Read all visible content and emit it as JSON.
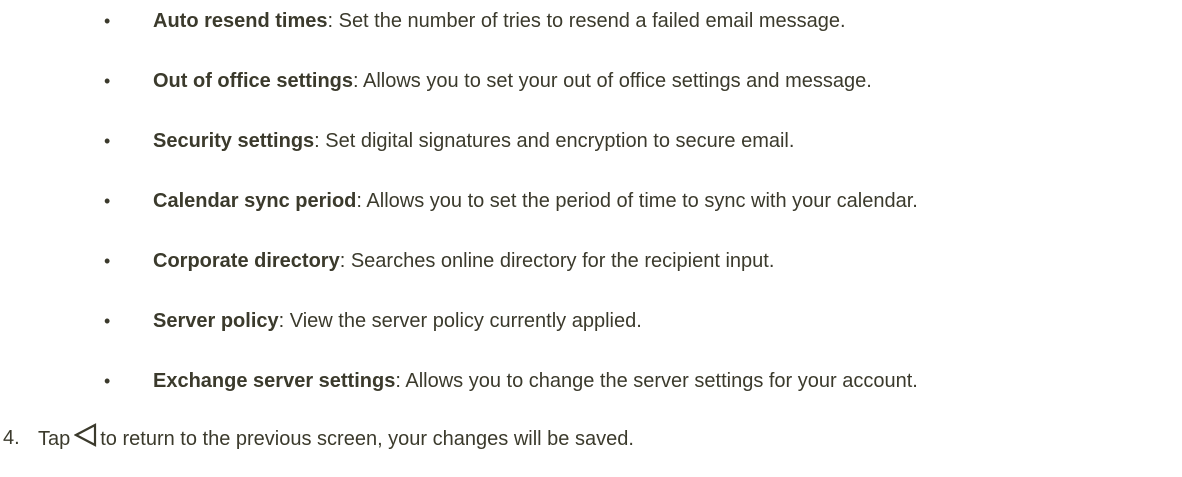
{
  "bullets": [
    {
      "term": "Auto resend times",
      "desc": ": Set the number of tries to resend a failed email message."
    },
    {
      "term": "Out of office settings",
      "desc": ": Allows you to set your out of office settings and message."
    },
    {
      "term": "Security settings",
      "desc": ": Set digital signatures and encryption to secure email."
    },
    {
      "term": "Calendar sync period",
      "desc": ": Allows you to set the period of time to sync with your calendar."
    },
    {
      "term": "Corporate directory",
      "desc": ": Searches online directory for the recipient input."
    },
    {
      "term": "Server policy",
      "desc": ": View the server policy currently applied."
    },
    {
      "term": "Exchange server settings",
      "desc": ": Allows you to change the server settings for your account."
    }
  ],
  "bullet_symbol": "•",
  "step": {
    "number": "4.",
    "before_icon": "Tap",
    "icon": "back-triangle-icon",
    "after_icon": "to return to the previous screen, your changes will be saved."
  }
}
